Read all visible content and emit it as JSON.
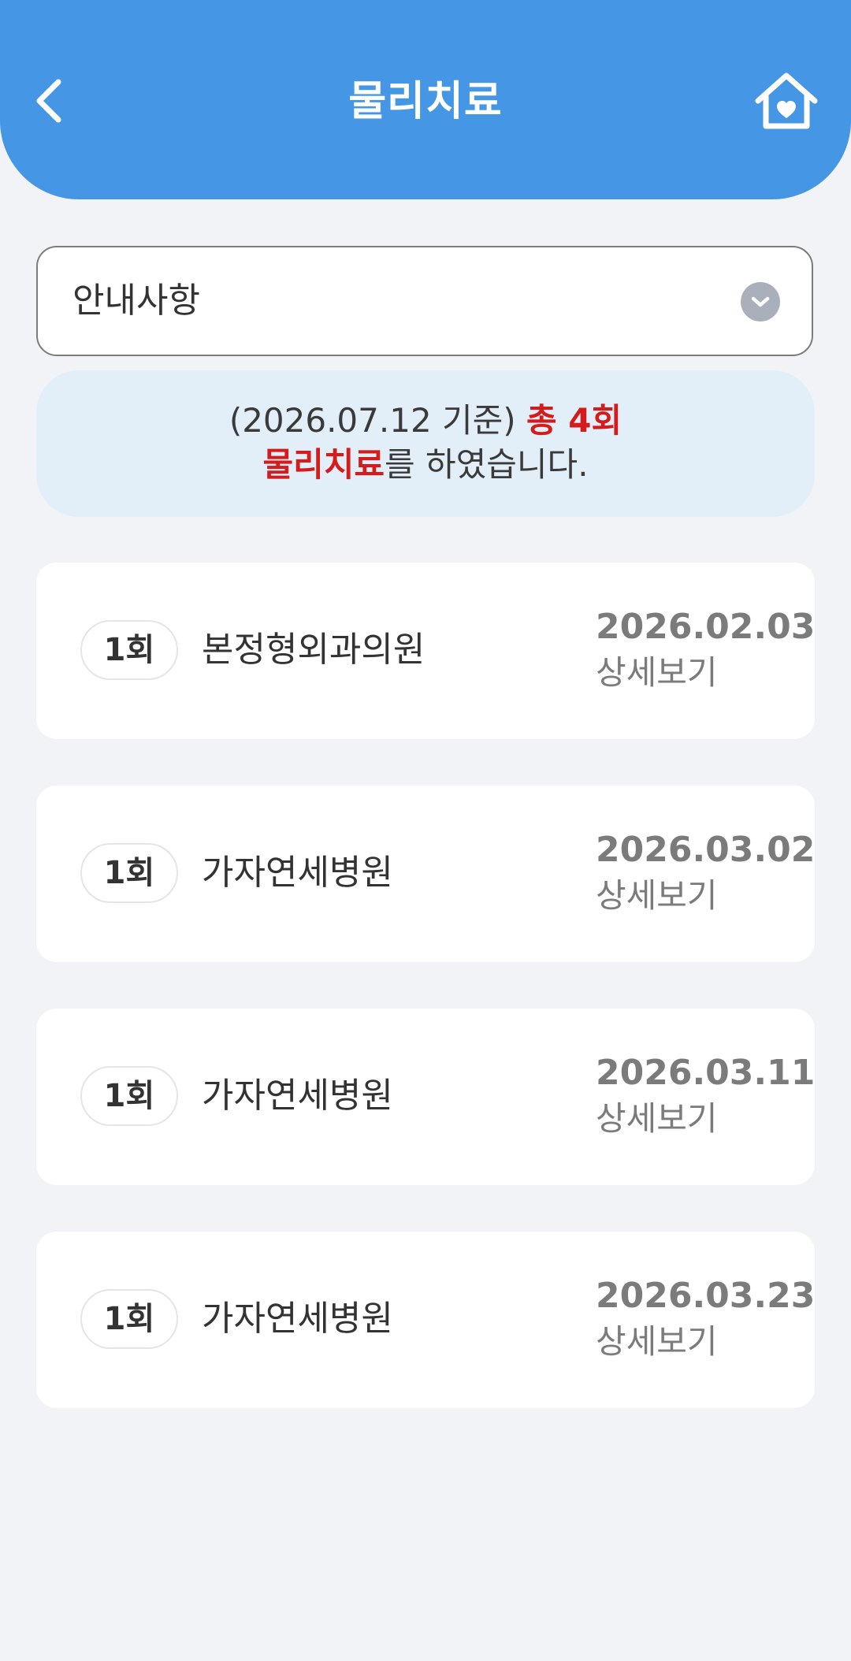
{
  "header": {
    "title": "물리치료"
  },
  "notice": {
    "label": "안내사항"
  },
  "summary": {
    "prefix": "(2026.07.12 기준) ",
    "total": "총 4회",
    "treatment": "물리치료",
    "suffix": "를 하였습니다."
  },
  "records": [
    {
      "count": "1회",
      "hospital": "본정형외과의원",
      "date": "2026.02.03",
      "detail": "상세보기"
    },
    {
      "count": "1회",
      "hospital": "가자연세병원",
      "date": "2026.03.02",
      "detail": "상세보기"
    },
    {
      "count": "1회",
      "hospital": "가자연세병원",
      "date": "2026.03.11",
      "detail": "상세보기"
    },
    {
      "count": "1회",
      "hospital": "가자연세병원",
      "date": "2026.03.23",
      "detail": "상세보기"
    }
  ],
  "colors": {
    "header": "#4696e6",
    "accent_red": "#d41c1c",
    "summary_bg": "#e2eef8",
    "background": "#f1f3f6"
  },
  "icons": {
    "back": "chevron-left-icon",
    "home": "home-heart-icon",
    "dropdown": "chevron-down-icon"
  }
}
